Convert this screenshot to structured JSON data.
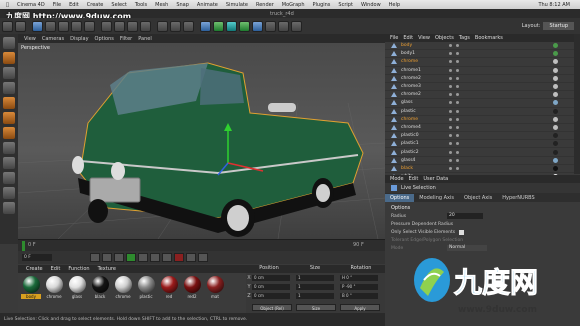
{
  "menubar": {
    "items": [
      "Cinema 4D",
      "File",
      "Edit",
      "Create",
      "Select",
      "Tools",
      "Mesh",
      "Snap",
      "Animate",
      "Simulate",
      "Render",
      "MoGraph",
      "Plugins",
      "Script",
      "Window",
      "Help"
    ],
    "clock": "Thu 8:12 AM",
    "window_title": "truck_r4d"
  },
  "watermark": {
    "site_text": "九度网 http://www.9duw.com",
    "bottom_text": "www.9duw.com",
    "logo_chars": "九度网"
  },
  "viewport": {
    "menu": [
      "View",
      "Cameras",
      "Display",
      "Options",
      "Filter",
      "Panel"
    ],
    "label": "Perspective"
  },
  "layout": {
    "label": "Layout:",
    "value": "Startup"
  },
  "object_manager": {
    "menu": [
      "File",
      "Edit",
      "View",
      "Objects",
      "Tags",
      "Bookmarks"
    ],
    "objects": [
      {
        "name": "body",
        "highlight": true,
        "tag_color": "#4a9a4a"
      },
      {
        "name": "body1",
        "highlight": false,
        "tag_color": "#4a9a4a"
      },
      {
        "name": "chrome",
        "highlight": true,
        "tag_color": "#bfbfbf"
      },
      {
        "name": "chrome1",
        "highlight": false,
        "tag_color": "#bfbfbf"
      },
      {
        "name": "chrome2",
        "highlight": false,
        "tag_color": "#bfbfbf"
      },
      {
        "name": "chrome3",
        "highlight": false,
        "tag_color": "#bfbfbf"
      },
      {
        "name": "chrome2",
        "highlight": false,
        "tag_color": "#bfbfbf"
      },
      {
        "name": "glass",
        "highlight": false,
        "tag_color": "#7fa7c7"
      },
      {
        "name": "plastic",
        "highlight": false,
        "tag_color": "#222222"
      },
      {
        "name": "chrome",
        "highlight": true,
        "tag_color": "#bfbfbf"
      },
      {
        "name": "chrome4",
        "highlight": false,
        "tag_color": "#bfbfbf"
      },
      {
        "name": "plastic0",
        "highlight": false,
        "tag_color": "#222222"
      },
      {
        "name": "plastic1",
        "highlight": false,
        "tag_color": "#222222"
      },
      {
        "name": "plastic2",
        "highlight": false,
        "tag_color": "#222222"
      },
      {
        "name": "glass4",
        "highlight": false,
        "tag_color": "#7fa7c7"
      },
      {
        "name": "black",
        "highlight": true,
        "tag_color": "#111111"
      },
      {
        "name": "white",
        "highlight": false,
        "tag_color": "#eeeeee"
      }
    ]
  },
  "attribute_manager": {
    "menu": [
      "Mode",
      "Edit",
      "User Data"
    ],
    "title": "Live Selection",
    "tabs": [
      "Options",
      "Modeling Axis",
      "Object Axis",
      "HyperNURBS"
    ],
    "section": "Options",
    "radius_label": "Radius",
    "radius_value": "20",
    "pressure_label": "Pressure Dependent Radius",
    "only_visible_label": "Only Select Visible Elements",
    "tolerant_label": "Tolerant Edge/Polygon Selection",
    "mode_label": "Mode",
    "mode_value": "Normal"
  },
  "materials": {
    "menu": [
      "Create",
      "Edit",
      "Function",
      "Texture"
    ],
    "items": [
      {
        "name": "body",
        "color": "#1a6a3a",
        "selected": true
      },
      {
        "name": "chrome",
        "color": "#d8d8d8",
        "selected": false
      },
      {
        "name": "glass",
        "color": "#e0e0e0",
        "selected": false
      },
      {
        "name": "black",
        "color": "#141414",
        "selected": false
      },
      {
        "name": "chrome",
        "color": "#cfcfcf",
        "selected": false
      },
      {
        "name": "plastic",
        "color": "#8a8a8a",
        "selected": false
      },
      {
        "name": "red",
        "color": "#9a1a1a",
        "selected": false
      },
      {
        "name": "red2",
        "color": "#7a1010",
        "selected": false
      },
      {
        "name": "mat",
        "color": "#8a2020",
        "selected": false
      }
    ]
  },
  "coordinates": {
    "headers": [
      "Position",
      "Size",
      "Rotation"
    ],
    "rows": [
      {
        "axis": "X",
        "pos": "0 cm",
        "size": "1",
        "rot": "H  0 °"
      },
      {
        "axis": "Y",
        "pos": "0 cm",
        "size": "1",
        "rot": "P  -90 °"
      },
      {
        "axis": "Z",
        "pos": "0 cm",
        "size": "1",
        "rot": "B  0 °"
      }
    ],
    "mode_left": "Object (Rel)",
    "mode_mid": "Size",
    "apply": "Apply"
  },
  "timeline": {
    "start": "0 F",
    "end": "90 F",
    "current": "0 F"
  },
  "status": "Live Selection: Click and drag to select elements. Hold down SHIFT to add to the selection, CTRL to remove."
}
